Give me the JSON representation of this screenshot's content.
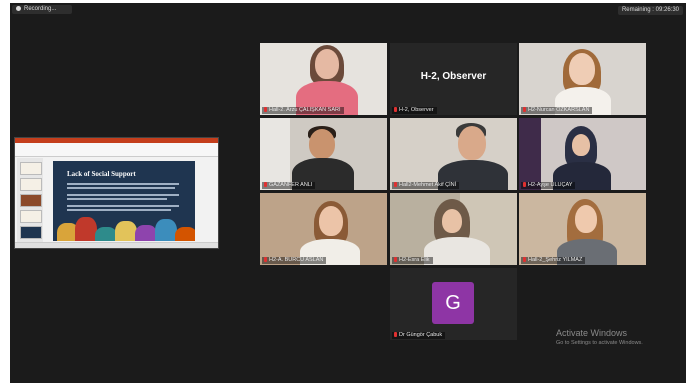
{
  "top_bar": {
    "recording_label": "Recording...",
    "remaining_label": "Remaining : 09:26:30"
  },
  "shared_screen": {
    "slide_title": "Lack of Social Support"
  },
  "participants": [
    {
      "name": "Hall-2. Arzu ÇALIŞKAN SARI",
      "active": true
    },
    {
      "name": "H-2, Observer",
      "display": "H-2, Observer"
    },
    {
      "name": "H2-Nurcan ÖZKARSLAN"
    },
    {
      "name": "GAZANFER ANLI"
    },
    {
      "name": "Hall2-Mehmet Akif ÇİNİ"
    },
    {
      "name": "H2-Ayşe ULUÇAY"
    },
    {
      "name": "H2-A. BURCU ASLAN"
    },
    {
      "name": "H2-Esra Elik"
    },
    {
      "name": "Hall-2_Şehriz YILMAZ"
    },
    {
      "name": "Dr Güngör Çabuk",
      "avatar_letter": "G",
      "avatar_color": "#8e35a5"
    }
  ],
  "watermark": {
    "title": "Activate Windows",
    "subtitle": "Go to Settings to activate Windows."
  },
  "colors": {
    "background": "#1b1b1b",
    "active_speaker": "#9acd32",
    "muted_mic": "#e03030"
  }
}
